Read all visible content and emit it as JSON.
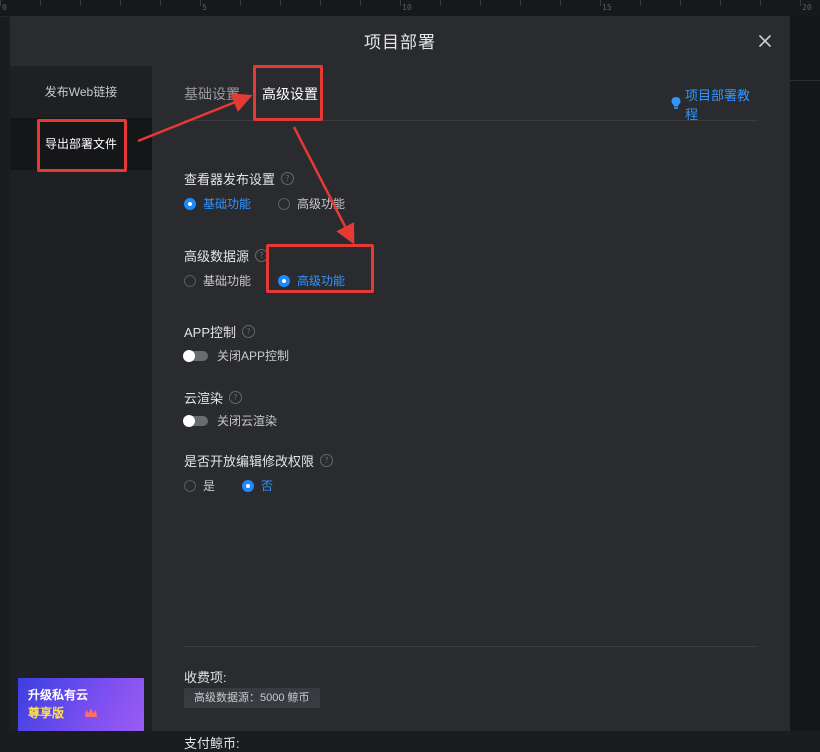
{
  "ruler": {
    "numbers": [
      "0",
      "5",
      "10",
      "15",
      "20"
    ]
  },
  "dialog": {
    "title": "项目部署",
    "close_icon": "close-icon"
  },
  "sidebar": {
    "items": [
      {
        "label": "发布Web链接",
        "active": false
      },
      {
        "label": "导出部署文件",
        "active": true
      }
    ],
    "upgrade": {
      "line1": "升级私有云",
      "line2": "尊享版"
    }
  },
  "tabs": {
    "items": [
      {
        "label": "基础设置",
        "active": false
      },
      {
        "label": "高级设置",
        "active": true
      }
    ],
    "tutorial_label": "项目部署教程",
    "tutorial_icon": "bulb-icon"
  },
  "settings": {
    "viewer": {
      "label": "查看器发布设置",
      "options": [
        "基础功能",
        "高级功能"
      ],
      "selected": 0
    },
    "datasource": {
      "label": "高级数据源",
      "options": [
        "基础功能",
        "高级功能"
      ],
      "selected": 1
    },
    "app_control": {
      "label": "APP控制",
      "toggle_label": "关闭APP控制",
      "enabled": false
    },
    "cloud_render": {
      "label": "云渲染",
      "toggle_label": "关闭云渲染",
      "enabled": false
    },
    "edit_permission": {
      "label": "是否开放编辑修改权限",
      "options": [
        "是",
        "否"
      ],
      "selected": 1
    }
  },
  "fees": {
    "label": "收费项:",
    "item": "高级数据源：5000 鲸币",
    "pay_label": "支付鲸币:"
  },
  "colors": {
    "accent": "#1e88ff",
    "annotation": "#e53935",
    "dialog_bg": "#2a2b2f",
    "sidebar_bg": "#1f2023"
  }
}
